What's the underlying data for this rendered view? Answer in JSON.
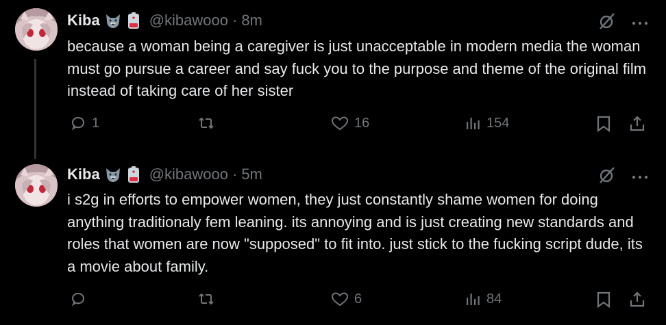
{
  "tweets": [
    {
      "name": "Kiba",
      "handle": "@kibawooo",
      "separator": "·",
      "time": "8m",
      "text": "because a woman being a caregiver is just unacceptable in modern media the woman must go pursue a career and say fuck you to the purpose and theme of the original film instead of taking care of her sister",
      "replies": "1",
      "likes": "16",
      "views": "154"
    },
    {
      "name": "Kiba",
      "handle": "@kibawooo",
      "separator": "·",
      "time": "5m",
      "text": "i s2g in efforts to empower women, they just constantly shame women for doing anything traditionaly fem leaning.  its annoying and is just creating new standards and roles that women are now \"supposed\" to fit into. just stick to the fucking script dude, its a movie about family.",
      "replies": "",
      "likes": "6",
      "views": "84"
    }
  ],
  "colors": {
    "background": "#000000",
    "text": "#e7e9ea",
    "muted": "#71767b",
    "thread_line": "#333639"
  },
  "icons": [
    "wolf-emoji-icon",
    "battery-emoji-icon",
    "grok-icon",
    "more-icon",
    "reply-icon",
    "retweet-icon",
    "like-icon",
    "views-icon",
    "bookmark-icon",
    "share-icon"
  ]
}
